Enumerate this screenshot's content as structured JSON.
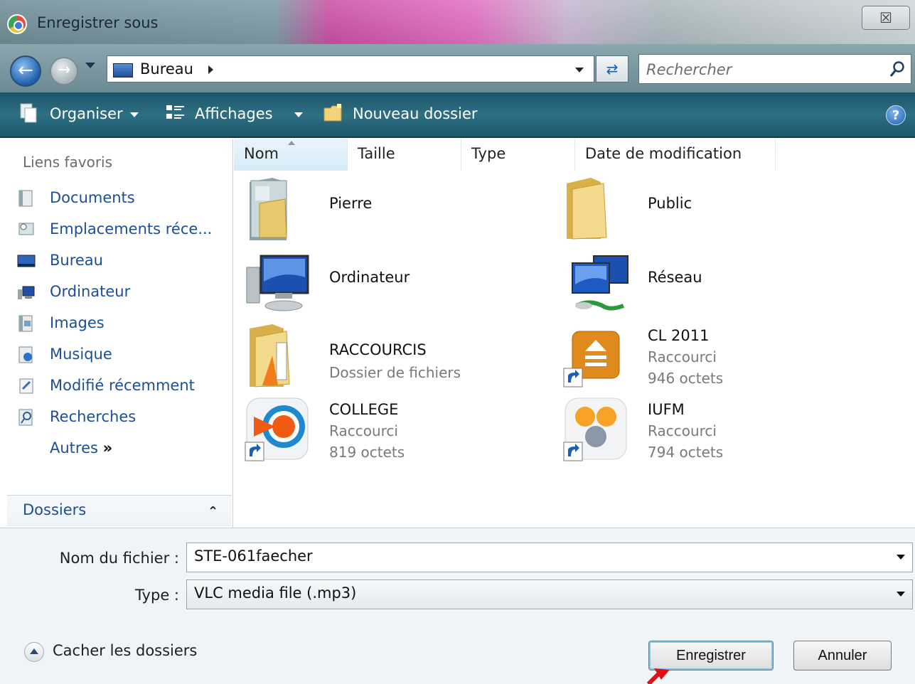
{
  "window": {
    "title": "Enregistrer sous",
    "close_glyph": "☒"
  },
  "nav": {
    "address": "Bureau",
    "search_placeholder": "Rechercher"
  },
  "toolbar": {
    "organize": "Organiser",
    "views": "Affichages",
    "new_folder": "Nouveau dossier",
    "help": "?"
  },
  "sidebar": {
    "heading": "Liens favoris",
    "items": [
      {
        "label": "Documents",
        "icon": "documents-icon"
      },
      {
        "label": "Emplacements réce...",
        "icon": "recent-places-icon"
      },
      {
        "label": "Bureau",
        "icon": "desktop-icon"
      },
      {
        "label": "Ordinateur",
        "icon": "computer-icon"
      },
      {
        "label": "Images",
        "icon": "pictures-icon"
      },
      {
        "label": "Musique",
        "icon": "music-icon"
      },
      {
        "label": "Modifié récemment",
        "icon": "recently-changed-icon"
      },
      {
        "label": "Recherches",
        "icon": "searches-icon"
      },
      {
        "label": "Autres",
        "icon": "more-icon"
      }
    ],
    "more_glyph": "»",
    "folders_label": "Dossiers"
  },
  "columns": [
    "Nom",
    "Taille",
    "Type",
    "Date de modification"
  ],
  "files": [
    {
      "name": "Pierre",
      "icon": "user-folder-icon"
    },
    {
      "name": "Public",
      "icon": "folder-icon"
    },
    {
      "name": "Ordinateur",
      "icon": "computer-icon"
    },
    {
      "name": "Réseau",
      "icon": "network-icon"
    },
    {
      "name": "RACCOURCIS",
      "sub1": "Dossier de fichiers",
      "icon": "folder-icon"
    },
    {
      "name": "CL 2011",
      "sub1": "Raccourci",
      "sub2": "946 octets",
      "icon": "shortcut-icon"
    },
    {
      "name": "COLLEGE",
      "sub1": "Raccourci",
      "sub2": "819 octets",
      "icon": "shortcut-icon"
    },
    {
      "name": "IUFM",
      "sub1": "Raccourci",
      "sub2": "794 octets",
      "icon": "shortcut-icon"
    }
  ],
  "form": {
    "filename_label": "Nom du fichier :",
    "filename_value": "STE-061faecher",
    "type_label": "Type :",
    "type_value": "VLC media file (.mp3)"
  },
  "footer": {
    "hide_folders": "Cacher les dossiers",
    "save": "Enregistrer",
    "cancel": "Annuler"
  },
  "colors": {
    "toolbar": "#2d6f83",
    "link": "#1c4f92",
    "annotation_arrow": "#e0101a"
  }
}
